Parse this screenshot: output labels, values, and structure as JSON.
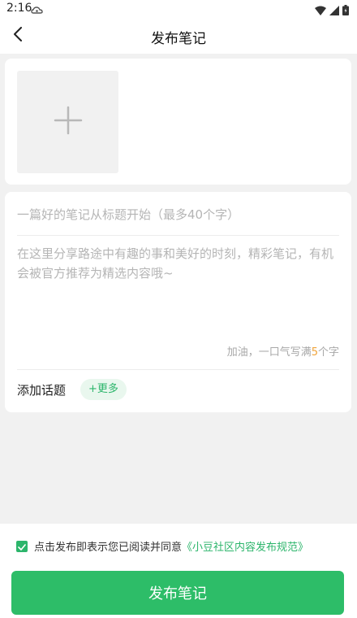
{
  "status_bar": {
    "time": "2:16"
  },
  "header": {
    "title": "发布笔记",
    "back_icon": "chevron-left-icon"
  },
  "image_section": {
    "add_icon": "plus-icon"
  },
  "editor": {
    "title_placeholder": "一篇好的笔记从标题开始（最多40个字）",
    "content_placeholder": "在这里分享路途中有趣的事和美好的时刻，精彩笔记，有机会被官方推荐为精选内容哦~",
    "counter_prefix": "加油，一口气写满",
    "counter_number": "5",
    "counter_suffix": "个字",
    "topic_label": "添加话题",
    "topic_more_label": "+更多"
  },
  "agreement": {
    "checked": true,
    "text": "点击发布即表示您已阅读并同意",
    "link": "《小豆社区内容发布规范》"
  },
  "publish_button": {
    "label": "发布笔记"
  },
  "colors": {
    "accent": "#2cb56b",
    "publish_button": "#2dbd68",
    "counter_highlight": "#f0a43a",
    "page_background": "#f1f1f1"
  }
}
